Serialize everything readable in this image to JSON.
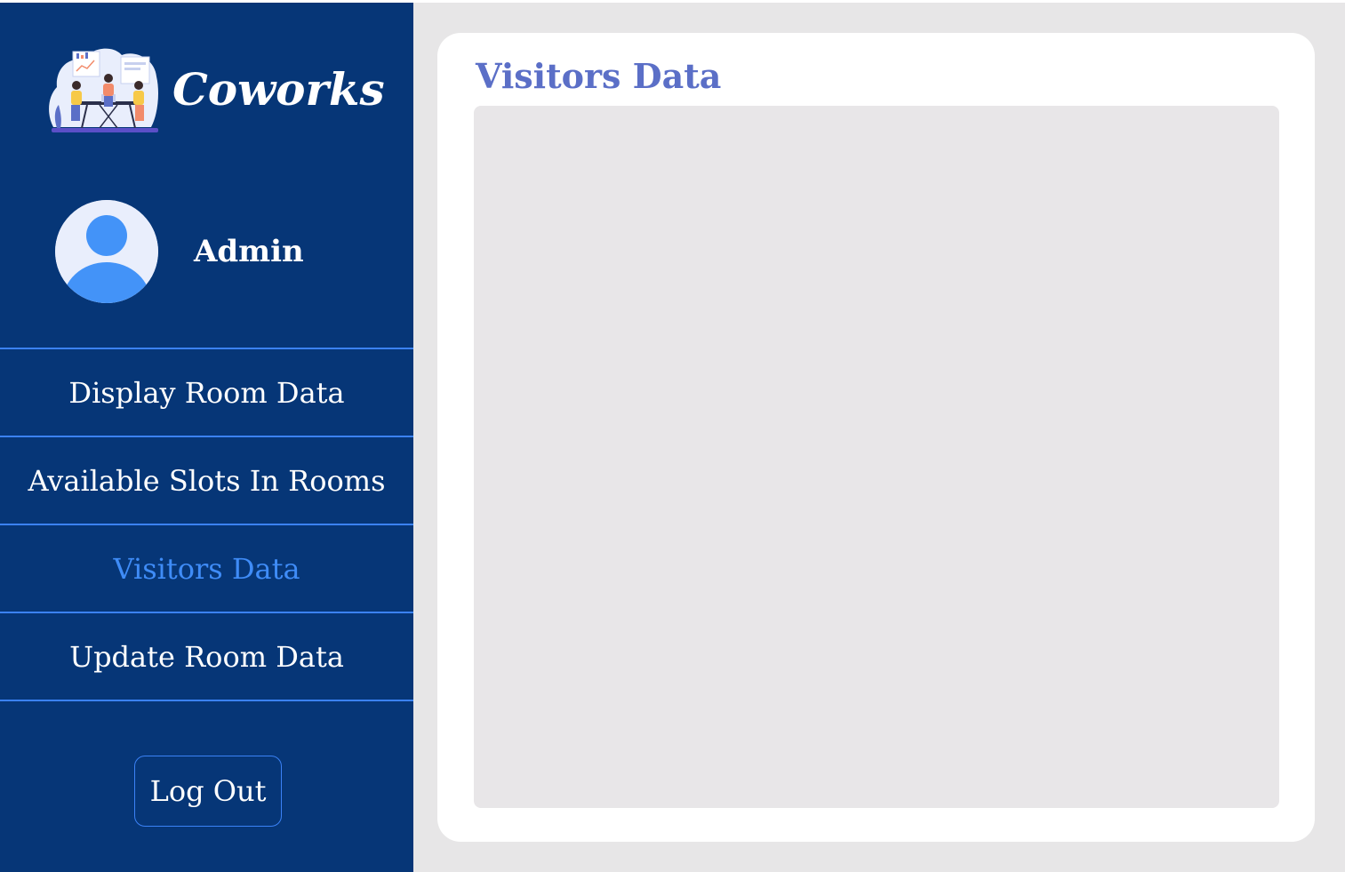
{
  "brand": {
    "name": "Coworks",
    "logo_icon": "coworking-team-illustration"
  },
  "profile": {
    "name": "Admin",
    "avatar_icon": "user-avatar-icon"
  },
  "nav": {
    "items": [
      {
        "label": "Display Room Data",
        "active": false
      },
      {
        "label": "Available Slots In Rooms",
        "active": false
      },
      {
        "label": "Visitors Data",
        "active": true
      },
      {
        "label": "Update Room Data",
        "active": false
      }
    ]
  },
  "logout": {
    "label": "Log Out"
  },
  "main": {
    "title": "Visitors Data"
  },
  "colors": {
    "sidebar_bg": "#063677",
    "accent": "#3f8cf7",
    "divider": "#3b82f6",
    "title": "#5b6fc7",
    "main_bg": "#e7e6e7"
  }
}
